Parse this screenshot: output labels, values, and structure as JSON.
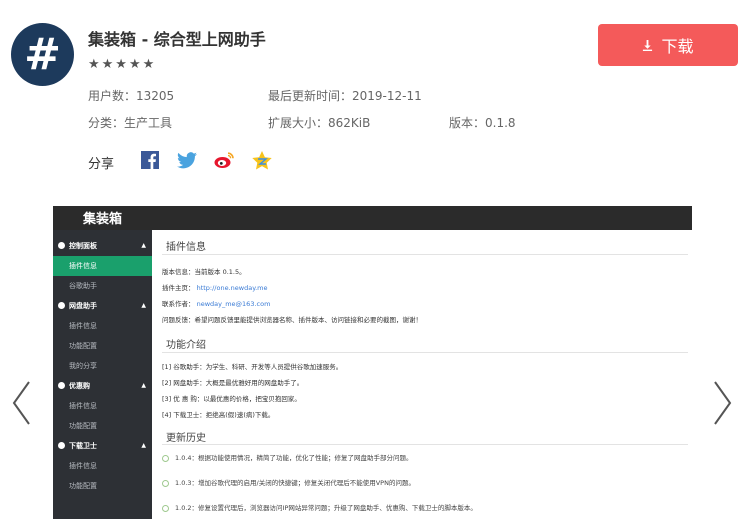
{
  "app": {
    "logo_symbol": "#",
    "title": "集装箱 - 综合型上网助手",
    "rating_stars": "★★★★★",
    "rating": 5,
    "users": "用户数：13205",
    "updated": "最后更新时间：2019-12-11",
    "category": "分类：生产工具",
    "size": "扩展大小：862KiB",
    "version": "版本：0.1.8",
    "download_label": "下载",
    "share_label": "分享",
    "share_icons": [
      "facebook-icon",
      "twitter-icon",
      "weibo-icon",
      "qzone-icon"
    ]
  },
  "colors": {
    "logo_bg": "#1d3a5c",
    "download_bg": "#f45a5a",
    "sidebar_bg": "#2d3035",
    "active_green": "#1aa06c",
    "topbar_bg": "#2b2b2b"
  },
  "screenshot": {
    "brand": "集装箱",
    "sidebar": [
      {
        "label": "控制面板",
        "type": "head"
      },
      {
        "label": "插件信息",
        "type": "active"
      },
      {
        "label": "谷歌助手",
        "type": "item"
      },
      {
        "label": "网盘助手",
        "type": "head"
      },
      {
        "label": "插件信息",
        "type": "item"
      },
      {
        "label": "功能配置",
        "type": "item"
      },
      {
        "label": "我的分享",
        "type": "item"
      },
      {
        "label": "优惠购",
        "type": "head"
      },
      {
        "label": "插件信息",
        "type": "item"
      },
      {
        "label": "功能配置",
        "type": "item"
      },
      {
        "label": "下载卫士",
        "type": "head"
      },
      {
        "label": "插件信息",
        "type": "item"
      },
      {
        "label": "功能配置",
        "type": "item"
      }
    ],
    "plugin_info": {
      "title": "插件信息",
      "version_text": "版本信息：当前版本 0.1.5。",
      "home_label": "插件主页：",
      "home_link": "http://one.newday.me",
      "author_label": "联系作者：",
      "author_link": "newday_me@163.com",
      "feedback": "问题反馈：希望问题反馈里能提供浏览器名称、插件版本、访问链接和必要的截图，谢谢！"
    },
    "features": {
      "title": "功能介绍",
      "items": [
        "[1] 谷歌助手：为学生、科研、开发等人员提供谷歌加速服务。",
        "[2] 网盘助手：大概是最优雅好用的网盘助手了。",
        "[3] 优 惠 购：以最优惠的价格，把宝贝抱回家。",
        "[4] 下载卫士：拒绝高(假)速(病)下载。"
      ]
    },
    "history": {
      "title": "更新历史",
      "items": [
        "1.0.4：根据功能使用情况，精简了功能，优化了性能；修复了网盘助手部分问题。",
        "1.0.3：增加谷歌代理的启用/关闭的快捷键；修复关闭代理后不能使用VPN的问题。",
        "1.0.2：修复设置代理后，浏览器访问IP网站异常问题；升级了网盘助手、优惠购、下载卫士的脚本版本。"
      ]
    }
  }
}
